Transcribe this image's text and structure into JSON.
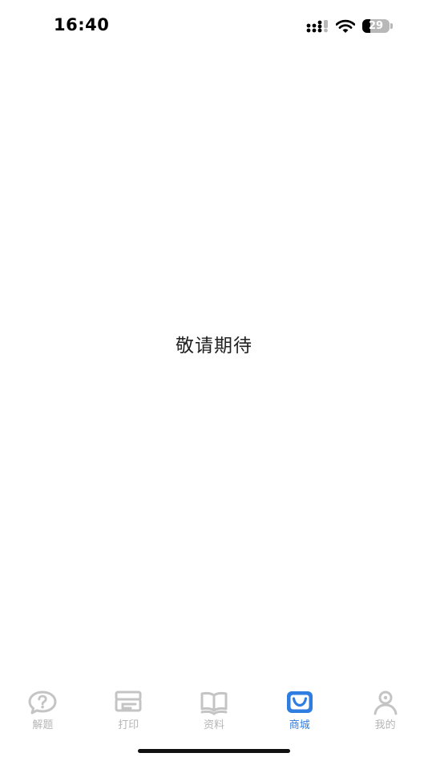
{
  "status_bar": {
    "time": "16:40",
    "battery_level": "29",
    "battery_fraction": 0.29
  },
  "main": {
    "message": "敬请期待"
  },
  "tab_bar": {
    "tabs": [
      {
        "label": "解题",
        "icon": "question-bubble-icon",
        "active": false
      },
      {
        "label": "打印",
        "icon": "printer-icon",
        "active": false
      },
      {
        "label": "资料",
        "icon": "book-icon",
        "active": false
      },
      {
        "label": "商城",
        "icon": "shop-bag-icon",
        "active": true
      },
      {
        "label": "我的",
        "icon": "person-icon",
        "active": false
      }
    ]
  },
  "colors": {
    "active": "#2f7de1",
    "inactive": "#b5b5b5",
    "icon_inactive": "#c4c4c4"
  }
}
